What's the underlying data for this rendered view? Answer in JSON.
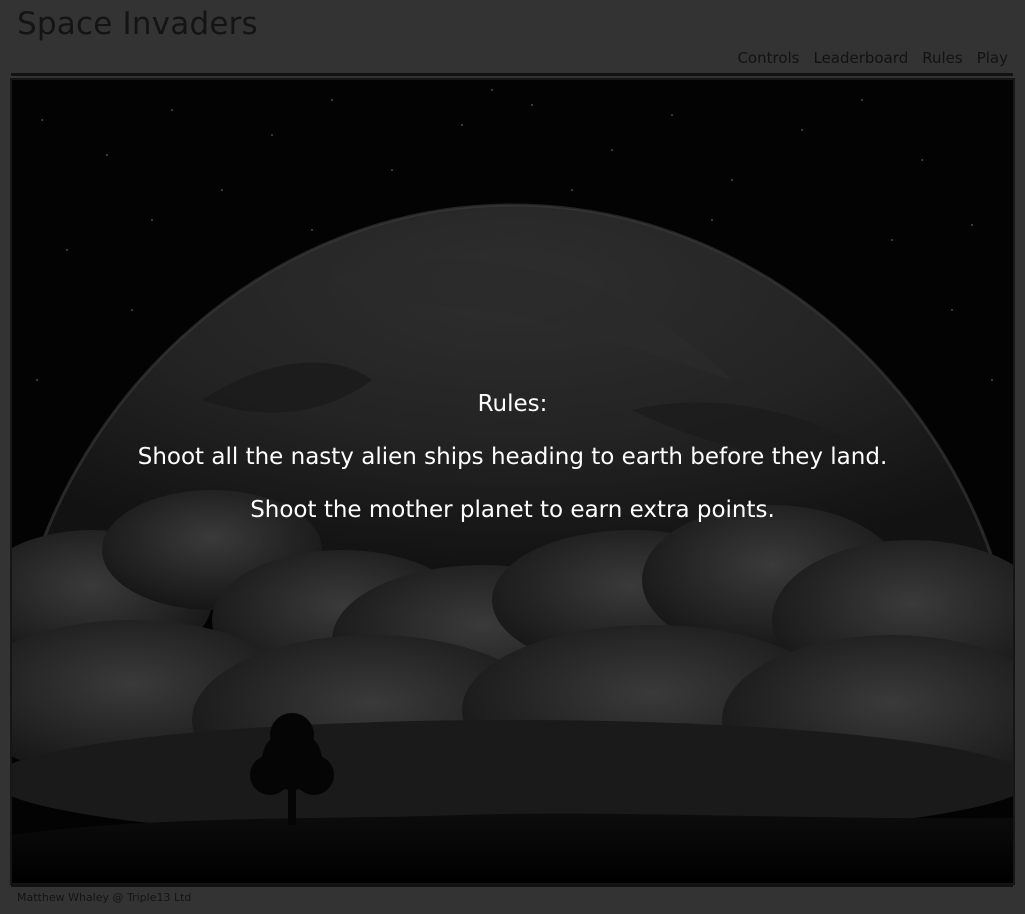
{
  "header": {
    "title": "Space Invaders",
    "nav": [
      "Controls",
      "Leaderboard",
      "Rules",
      "Play"
    ]
  },
  "rules": {
    "heading": "Rules:",
    "lines": [
      "Shoot all the nasty alien ships heading to earth before they land.",
      "Shoot the mother planet to earn extra points."
    ]
  },
  "footer": {
    "credit": "Matthew Whaley @ Triple13 Ltd"
  },
  "colors": {
    "page_background": "#333333",
    "header_text": "#141414",
    "rules_text": "#ffffff",
    "stage_background": "#020202"
  }
}
